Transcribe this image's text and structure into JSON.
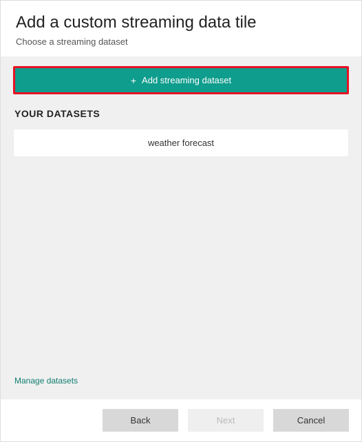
{
  "header": {
    "title": "Add a custom streaming data tile",
    "subtitle": "Choose a streaming dataset"
  },
  "main": {
    "addButtonLabel": "Add streaming dataset",
    "sectionHeading": "YOUR DATASETS",
    "datasets": [
      {
        "label": "weather forecast"
      }
    ],
    "manageLinkLabel": "Manage datasets"
  },
  "footer": {
    "backLabel": "Back",
    "nextLabel": "Next",
    "cancelLabel": "Cancel"
  },
  "colors": {
    "accent": "#0f9d8d",
    "highlight": "#e81123",
    "panelBg": "#f0f0f0"
  }
}
